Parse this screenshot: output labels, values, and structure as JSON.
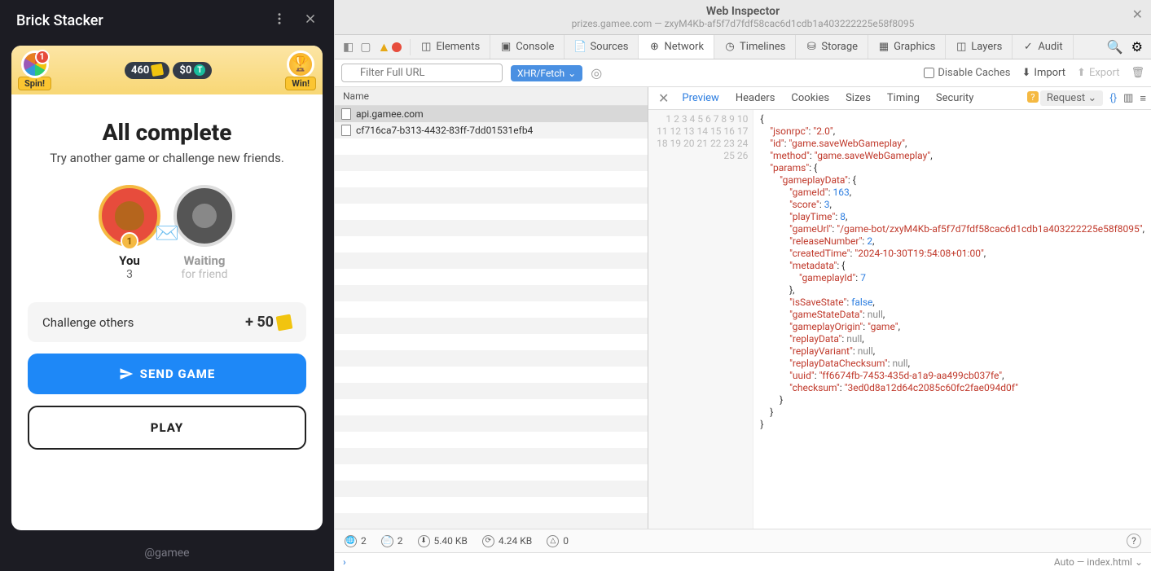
{
  "game": {
    "title": "Brick Stacker",
    "topbar": {
      "spinLabel": "Spin!",
      "spinNotif": "1",
      "tickets": "460",
      "balance": "$0",
      "winLabel": "Win!"
    },
    "complete": {
      "title": "All complete",
      "subtitle": "Try another game or challenge new friends."
    },
    "players": {
      "you": {
        "name": "You",
        "score": "3",
        "rank": "1"
      },
      "wait": {
        "name": "Waiting",
        "sub": "for friend"
      }
    },
    "challenge": {
      "label": "Challenge others",
      "reward": "+ 50"
    },
    "buttons": {
      "send": "SEND GAME",
      "play": "PLAY"
    },
    "footer": "@gamee"
  },
  "inspector": {
    "title": "Web Inspector",
    "subtitle": "prizes.gamee.com — zxyM4Kb-af5f7d7fdf58cac6d1cdb1a403222225e58f8095",
    "tabs": {
      "elements": "Elements",
      "console": "Console",
      "sources": "Sources",
      "network": "Network",
      "timelines": "Timelines",
      "storage": "Storage",
      "graphics": "Graphics",
      "layers": "Layers",
      "audit": "Audit"
    },
    "filter": {
      "placeholder": "Filter Full URL",
      "xhrLabel": "XHR/Fetch",
      "disableCaches": "Disable Caches",
      "import": "Import",
      "export": "Export"
    },
    "requests": {
      "nameHeader": "Name",
      "items": [
        "api.gamee.com",
        "cf716ca7-b313-4432-83ff-7dd01531efb4"
      ]
    },
    "previewTabs": {
      "preview": "Preview",
      "headers": "Headers",
      "cookies": "Cookies",
      "sizes": "Sizes",
      "timing": "Timing",
      "security": "Security",
      "request": "Request"
    },
    "json": {
      "jsonrpc": "2.0",
      "id": "game.saveWebGameplay",
      "method": "game.saveWebGameplay",
      "gameId": "163",
      "score": "3",
      "playTime": "8",
      "gameUrl": "/game-bot/zxyM4Kb-af5f7d7fdf58cac6d1cdb1a403222225e58f8095",
      "releaseNumber": "2",
      "createdTime": "2024-10-30T19:54:08+01:00",
      "gameplayId": "7",
      "isSaveState": "false",
      "gameplayOrigin": "game",
      "uuid": "ff6674fb-7453-435d-a1a9-aa499cb037fe",
      "checksum": "3ed0d8a12d64c2085c60fc2fae094d0f"
    },
    "status": {
      "globe": "2",
      "files": "2",
      "down": "5.40 KB",
      "time": "4.24 KB",
      "warn": "0"
    },
    "console": {
      "context": "Auto — index.html"
    }
  }
}
